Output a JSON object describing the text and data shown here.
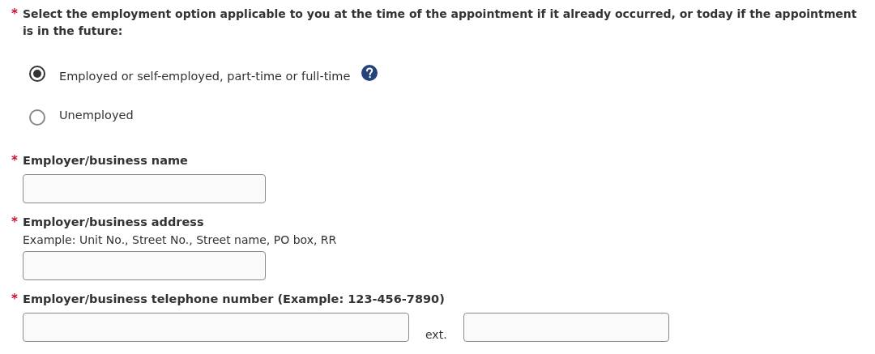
{
  "question": {
    "required_mark": "*",
    "text": "Select the employment option applicable to you at the time of the appointment if it already occurred, or today if the appointment is in the future:"
  },
  "options": [
    {
      "label": "Employed or self-employed, part-time or full-time",
      "selected": true,
      "help": true
    },
    {
      "label": "Unemployed",
      "selected": false
    }
  ],
  "fields": [
    {
      "required_mark": "*",
      "label": "Employer/business name"
    },
    {
      "required_mark": "*",
      "label": "Employer/business address",
      "hint": "Example: Unit No., Street No., Street name, PO box, RR"
    },
    {
      "required_mark": "*",
      "label": "Employer/business telephone number (Example: 123-456-7890)",
      "extension_label": "ext."
    }
  ]
}
